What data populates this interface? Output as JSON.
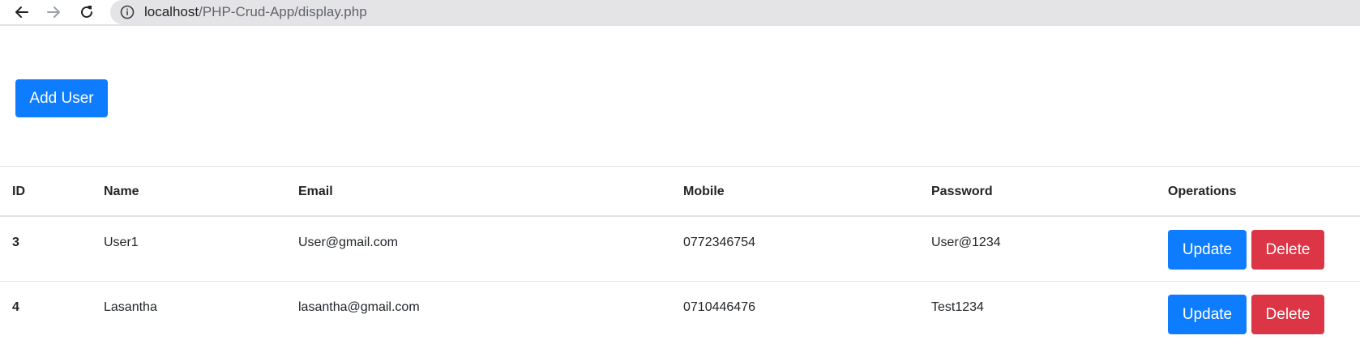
{
  "browser": {
    "url_host": "localhost",
    "url_path": "/PHP-Crud-App/display.php"
  },
  "toolbar": {
    "add_user_label": "Add User"
  },
  "table": {
    "headers": {
      "id": "ID",
      "name": "Name",
      "email": "Email",
      "mobile": "Mobile",
      "password": "Password",
      "operations": "Operations"
    },
    "rows": [
      {
        "id": "3",
        "name": "User1",
        "email": "User@gmail.com",
        "mobile": "0772346754",
        "password": "User@1234",
        "update_label": "Update",
        "delete_label": "Delete"
      },
      {
        "id": "4",
        "name": "Lasantha",
        "email": "lasantha@gmail.com",
        "mobile": "0710446476",
        "password": "Test1234",
        "update_label": "Update",
        "delete_label": "Delete"
      }
    ]
  },
  "colors": {
    "primary": "#0d7cff",
    "danger": "#dc3545"
  },
  "icons": {
    "back": "arrow-left-icon",
    "forward": "arrow-right-icon",
    "reload": "reload-icon",
    "site_info": "info-icon"
  }
}
